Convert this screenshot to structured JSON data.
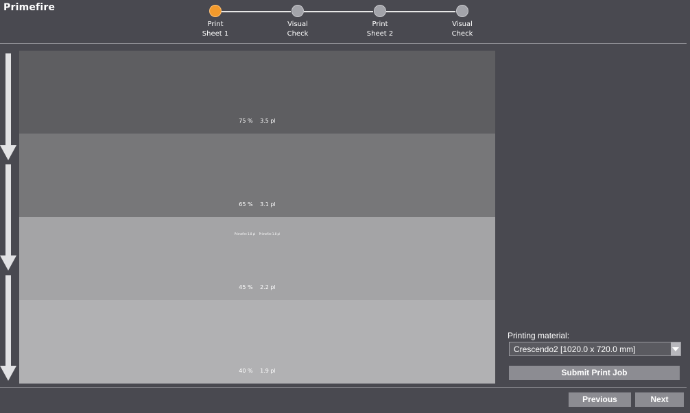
{
  "app": {
    "title": "Primefire"
  },
  "stepper": {
    "steps": [
      {
        "label": "Print\nSheet 1",
        "active": true
      },
      {
        "label": "Visual\nCheck",
        "active": false
      },
      {
        "label": "Print\nSheet 2",
        "active": false
      },
      {
        "label": "Visual\nCheck",
        "active": false
      }
    ]
  },
  "preview": {
    "bands": [
      {
        "percent": "75 %",
        "drop": "3.5 pl",
        "color": "#5e5e61"
      },
      {
        "percent": "65 %",
        "drop": "3.1 pl",
        "color": "#777779"
      },
      {
        "percent": "45 %",
        "drop": "2.2 pl",
        "color": "#a4a4a6",
        "tiny": [
          "Primefire 1.8 pl",
          "Primefire 1.8 pl"
        ]
      },
      {
        "percent": "40 %",
        "drop": "1.9 pl",
        "color": "#b1b1b3"
      }
    ]
  },
  "panel": {
    "material_label": "Printing material:",
    "material_value": "Crescendo2 [1020.0 x 720.0 mm]",
    "submit_label": "Submit Print Job"
  },
  "footer": {
    "previous_label": "Previous",
    "next_label": "Next"
  },
  "colors": {
    "background": "#494950",
    "accent": "#f39a2c",
    "button": "#8c8c92"
  }
}
